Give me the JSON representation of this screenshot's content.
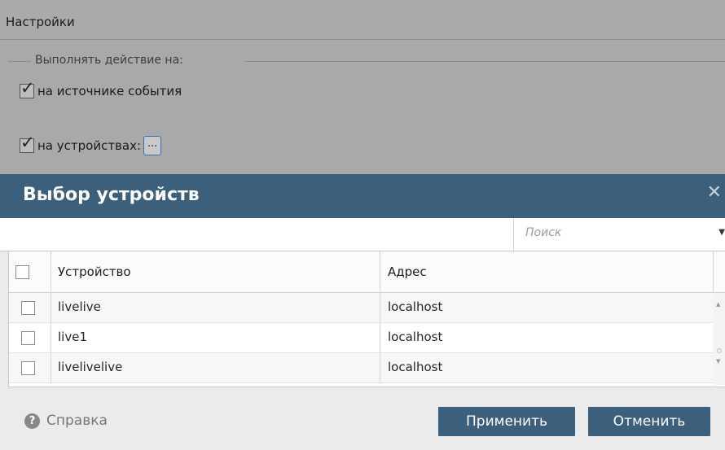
{
  "settings": {
    "title": "Настройки",
    "group_legend": "Выполнять действие на:",
    "option_source": {
      "label": "на источнике события",
      "checked": true
    },
    "option_devices": {
      "label": "на устройствах:",
      "checked": true
    },
    "browse_button": "..."
  },
  "dialog": {
    "title": "Выбор устройств",
    "close_glyph": "✕",
    "search": {
      "placeholder": "Поиск"
    },
    "table": {
      "columns": [
        "Устройство",
        "Адрес"
      ],
      "rows": [
        {
          "device": "livelive",
          "address": "localhost",
          "checked": false
        },
        {
          "device": "live1",
          "address": "localhost",
          "checked": false
        },
        {
          "device": "livelivelive",
          "address": "localhost",
          "checked": false
        }
      ]
    },
    "footer": {
      "help_label": "Справка",
      "apply_label": "Применить",
      "cancel_label": "Отменить"
    }
  },
  "colors": {
    "header_bg": "#3c5f7b",
    "button_bg": "#3c5f7b",
    "overlay_bg": "#a9a9a9"
  }
}
